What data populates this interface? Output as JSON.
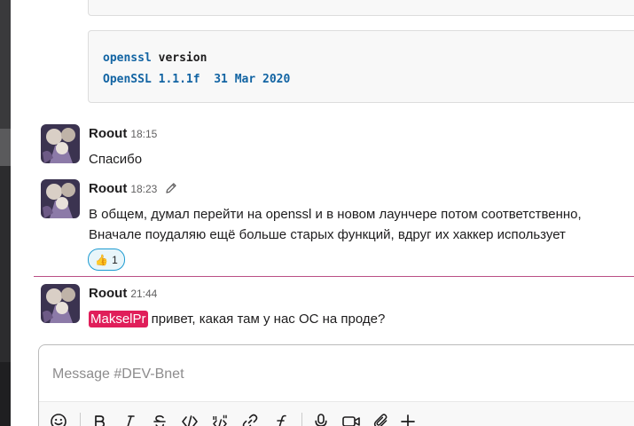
{
  "code_block": {
    "line1_keyword": "openssl",
    "line1_rest": " version",
    "line2": "OpenSSL 1.1.1f  31 Mar 2020"
  },
  "messages": [
    {
      "author": "Roout",
      "time": "18:15",
      "lines": [
        "Спасибо"
      ]
    },
    {
      "author": "Roout",
      "time": "18:23",
      "edited_icon": "pencil-icon",
      "lines": [
        "В общем, думал перейти на openssl и в новом лаунчере потом соответственно,",
        "Вначале поудаляю ещё больше старых функций, вдруг их хаккер использует"
      ],
      "reaction": {
        "emoji": "👍",
        "count": "1"
      }
    },
    {
      "author": "Roout",
      "time": "21:44",
      "mention": "MakselPr",
      "text_after_mention": " привет, какая там у нас ОС на проде?"
    }
  ],
  "composer": {
    "placeholder": "Message #DEV-Bnet",
    "tools": [
      "emoji-icon",
      "bold-icon",
      "italic-icon",
      "strikethrough-icon",
      "code-icon",
      "code-block-icon",
      "link-icon",
      "shortcut-icon",
      "mic-icon",
      "video-icon",
      "attach-icon",
      "plus-icon"
    ]
  },
  "colors": {
    "accent": "#1264a3",
    "mention_bg": "#e01e5a",
    "new_line": "#a3155c",
    "sidebar": "#3f0e40"
  }
}
